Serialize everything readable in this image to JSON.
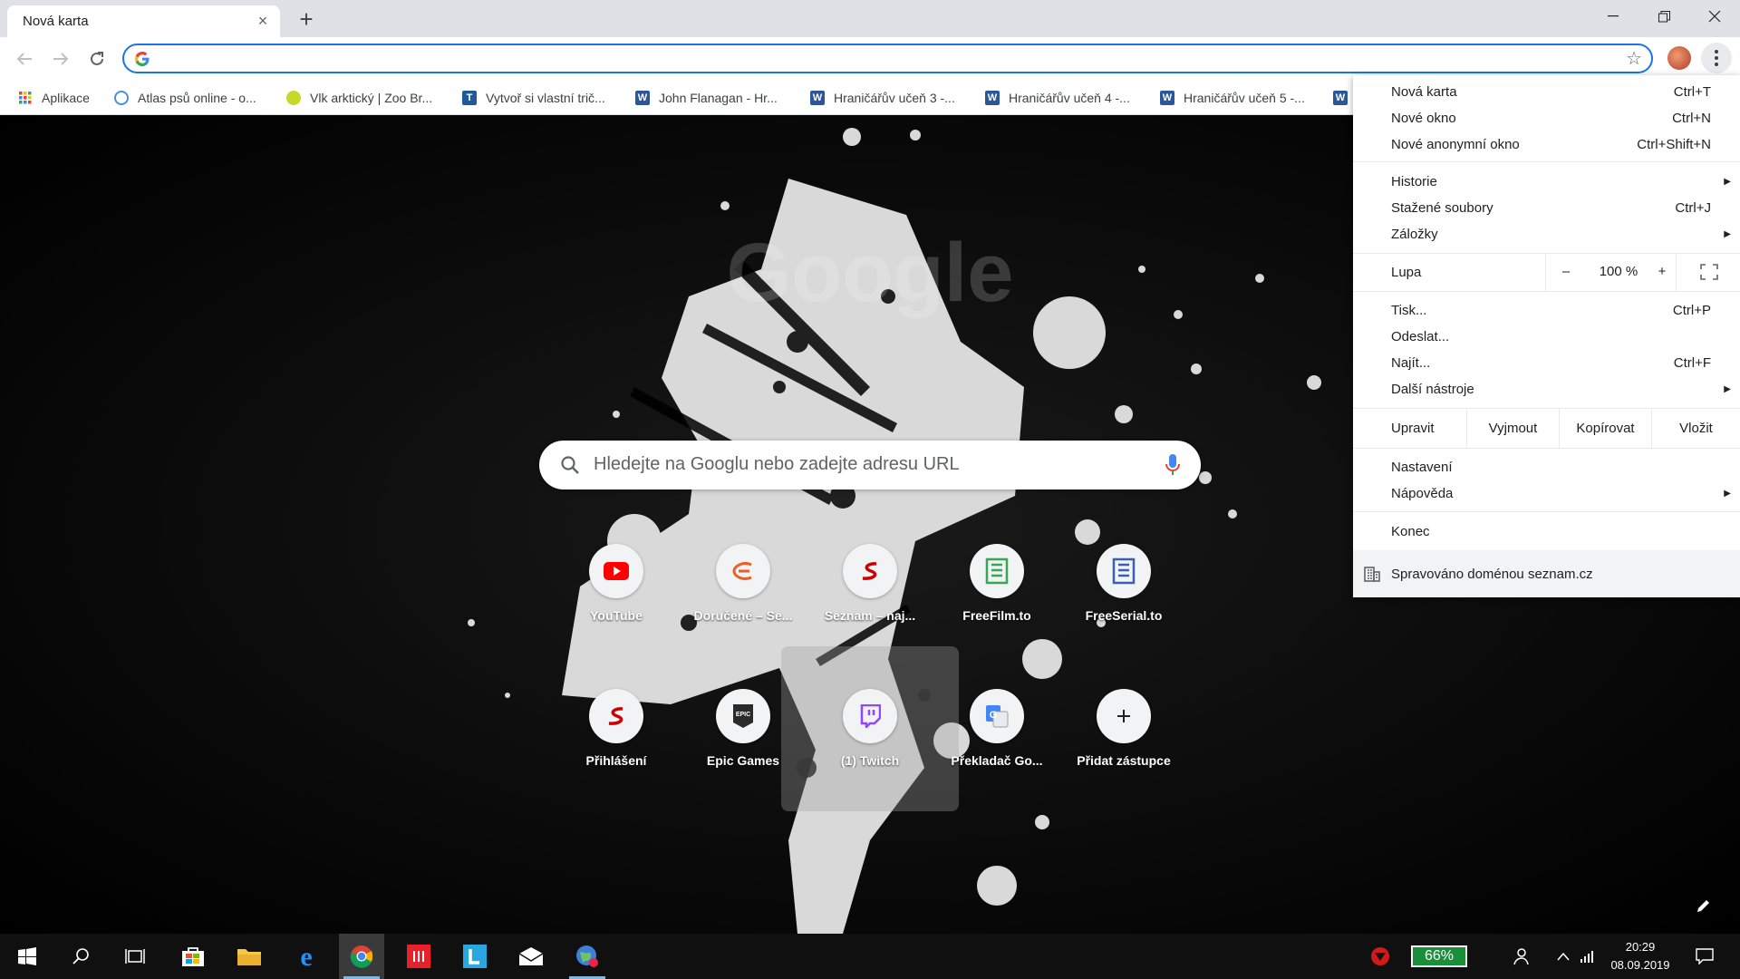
{
  "browser": {
    "tab_title": "Nová karta",
    "omnibox_value": ""
  },
  "bookmarks": [
    {
      "label": "Aplikace",
      "icon": "apps-grid-icon"
    },
    {
      "label": "Atlas psů online - o...",
      "icon": "atlas-icon"
    },
    {
      "label": "Vlk arktický | Zoo Br...",
      "icon": "zoo-icon"
    },
    {
      "label": "Vytvoř si vlastní trič...",
      "icon": "tshirt-icon"
    },
    {
      "label": "John Flanagan - Hr...",
      "icon": "wiki-icon"
    },
    {
      "label": "Hraničářův učeň 3 -...",
      "icon": "wiki-icon"
    },
    {
      "label": "Hraničářův učeň 4 -...",
      "icon": "wiki-icon"
    },
    {
      "label": "Hraničářův učeň 5 -...",
      "icon": "wiki-icon"
    }
  ],
  "newtab": {
    "search_placeholder": "Hledejte na Googlu nebo zadejte adresu URL",
    "shortcuts": [
      {
        "label": "YouTube",
        "icon": "youtube-icon"
      },
      {
        "label": "Doručené – Se...",
        "icon": "email-icon"
      },
      {
        "label": "Seznam – naj...",
        "icon": "seznam-icon"
      },
      {
        "label": "FreeFilm.to",
        "icon": "freefilm-icon"
      },
      {
        "label": "FreeSerial.to",
        "icon": "freeserial-icon"
      },
      {
        "label": "Přihlášení",
        "icon": "seznam-icon"
      },
      {
        "label": "Epic Games",
        "icon": "epic-games-icon"
      },
      {
        "label": "(1) Twitch",
        "icon": "twitch-icon"
      },
      {
        "label": "Překladač Go...",
        "icon": "google-translate-icon"
      },
      {
        "label": "Přidat zástupce",
        "icon": "plus-icon"
      }
    ]
  },
  "menu": {
    "new_tab": "Nová karta",
    "new_tab_key": "Ctrl+T",
    "new_window": "Nové okno",
    "new_window_key": "Ctrl+N",
    "incognito": "Nové anonymní okno",
    "incognito_key": "Ctrl+Shift+N",
    "history": "Historie",
    "downloads": "Stažené soubory",
    "downloads_key": "Ctrl+J",
    "bookmarks": "Záložky",
    "zoom_label": "Lupa",
    "zoom_minus": "–",
    "zoom_value": "100 %",
    "zoom_plus": "+",
    "print": "Tisk...",
    "print_key": "Ctrl+P",
    "cast": "Odeslat...",
    "find": "Najít...",
    "find_key": "Ctrl+F",
    "more_tools": "Další nástroje",
    "edit": "Upravit",
    "cut": "Vyjmout",
    "copy": "Kopírovat",
    "paste": "Vložit",
    "settings": "Nastavení",
    "help": "Nápověda",
    "exit": "Konec",
    "managed": "Spravováno doménou seznam.cz"
  },
  "taskbar": {
    "battery": "66%",
    "time": "20:29",
    "date": "08.09.2019"
  },
  "colors": {
    "accent": "#1a73e8",
    "tabstrip": "#dee1e6",
    "battery": "#1a8f3a"
  }
}
